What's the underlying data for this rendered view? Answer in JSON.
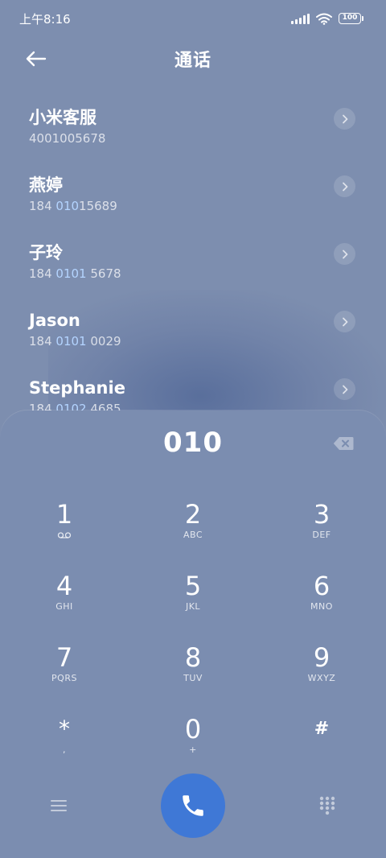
{
  "status_bar": {
    "time": "上午8:16",
    "battery": "100"
  },
  "header": {
    "title": "通话"
  },
  "contacts": [
    {
      "name": "小米客服",
      "number_pre": "4001005678",
      "number_hl": "",
      "number_post": ""
    },
    {
      "name": "燕婷",
      "number_pre": "184 ",
      "number_hl": "010",
      "number_post": "15689"
    },
    {
      "name": "子玲",
      "number_pre": "184 ",
      "number_hl": "0101",
      "number_post": " 5678"
    },
    {
      "name": "Jason",
      "number_pre": "184 ",
      "number_hl": "0101",
      "number_post": " 0029"
    },
    {
      "name": "Stephanie",
      "number_pre": "184 ",
      "number_hl": "0102",
      "number_post": " 4685"
    }
  ],
  "dialpad": {
    "input": "010",
    "keys": [
      {
        "digit": "1",
        "letters": ""
      },
      {
        "digit": "2",
        "letters": "ABC"
      },
      {
        "digit": "3",
        "letters": "DEF"
      },
      {
        "digit": "4",
        "letters": "GHI"
      },
      {
        "digit": "5",
        "letters": "JKL"
      },
      {
        "digit": "6",
        "letters": "MNO"
      },
      {
        "digit": "7",
        "letters": "PQRS"
      },
      {
        "digit": "8",
        "letters": "TUV"
      },
      {
        "digit": "9",
        "letters": "WXYZ"
      },
      {
        "digit": "*",
        "letters": ","
      },
      {
        "digit": "0",
        "letters": "+"
      },
      {
        "digit": "#",
        "letters": ""
      }
    ]
  },
  "icons": {
    "back": "back-arrow-icon",
    "info": "chevron-right-icon",
    "backspace": "backspace-icon",
    "voicemail": "voicemail-icon",
    "menu": "menu-icon",
    "call": "phone-icon",
    "keypad": "keypad-icon"
  },
  "colors": {
    "background": "#7d8eaf",
    "call_button": "#3f78d6",
    "highlight": "#b4d4ff"
  }
}
